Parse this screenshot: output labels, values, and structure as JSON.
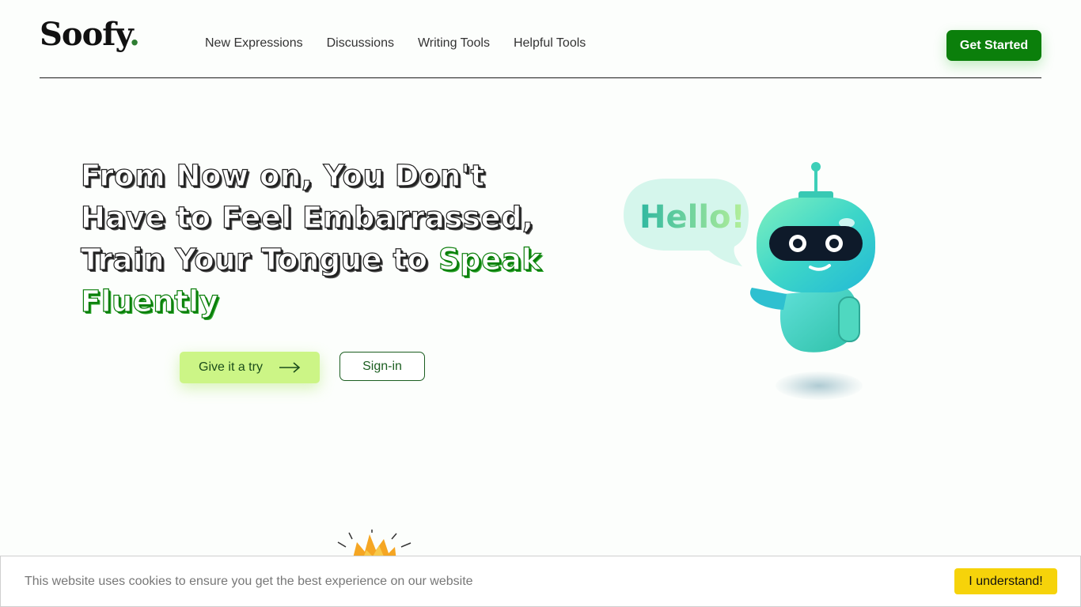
{
  "header": {
    "logo": "Soofy",
    "logo_dot": ".",
    "nav": [
      "New Expressions",
      "Discussions",
      "Writing Tools",
      "Helpful Tools"
    ],
    "cta_label": "Get Started"
  },
  "hero": {
    "title_line1": "From Now on, You Don't",
    "title_line2": "Have to Feel Embarrassed,",
    "title_line3": "Train Your Tongue to ",
    "title_highlight1": "Speak",
    "title_highlight2": "Fluently",
    "primary_button": "Give it a try",
    "secondary_button": "Sign-in",
    "bubble_text": "Hello!"
  },
  "cookie": {
    "message": "This website uses cookies to ensure you get the best experience on our website",
    "button": "I understand!"
  },
  "colors": {
    "brand_green": "#0b7f0b",
    "light_green": "#ccf586",
    "cookie_yellow": "#f6d30a"
  }
}
